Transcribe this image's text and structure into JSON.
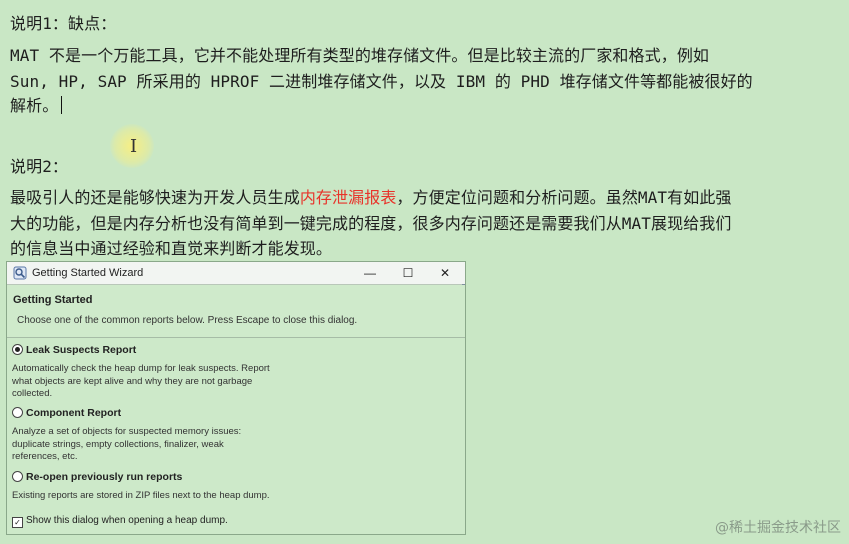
{
  "note1": {
    "heading": "说明1：缺点：",
    "line1": "MAT 不是一个万能工具，它并不能处理所有类型的堆存储文件。但是比较主流的厂家和格式，例如",
    "line2": "Sun, HP, SAP 所采用的 HPROF 二进制堆存储文件，以及 IBM 的 PHD 堆存储文件等都能被很好的",
    "line3": "解析。"
  },
  "note2": {
    "heading": "说明2：",
    "line1_pre": "最吸引人的还是能够快速为开发人员生成",
    "line1_red": "内存泄漏报表",
    "line1_post": "，方便定位问题和分析问题。虽然MAT有如此强",
    "line2": "大的功能，但是内存分析也没有简单到一键完成的程度，很多内存问题还是需要我们从MAT展现给我们",
    "line3": "的信息当中通过经验和直觉来判断才能发现。"
  },
  "dialog": {
    "window_title": "Getting Started Wizard",
    "minimize": "—",
    "maximize": "☐",
    "close": "✕",
    "header_title": "Getting Started",
    "header_desc": "Choose one of the common reports below. Press Escape to close this dialog.",
    "options": [
      {
        "label": "Leak Suspects Report",
        "selected": true,
        "desc": [
          "Automatically check the heap dump for leak suspects. Report",
          "what objects are kept alive and why they are not garbage",
          "collected."
        ]
      },
      {
        "label": "Component Report",
        "selected": false,
        "desc": [
          "Analyze a set of objects for suspected memory issues:",
          "duplicate strings, empty collections, finalizer, weak",
          "references, etc."
        ]
      },
      {
        "label": "Re-open previously run reports",
        "selected": false,
        "desc": [
          "Existing reports are stored in ZIP files next to the heap dump."
        ]
      }
    ],
    "show_checkbox_label": "Show this dialog when opening a heap dump.",
    "show_checkbox_checked": true
  },
  "watermark": "@稀土掘金技术社区",
  "icons": {
    "app": "mat-wizard-icon",
    "cursor": "text-cursor-icon"
  }
}
